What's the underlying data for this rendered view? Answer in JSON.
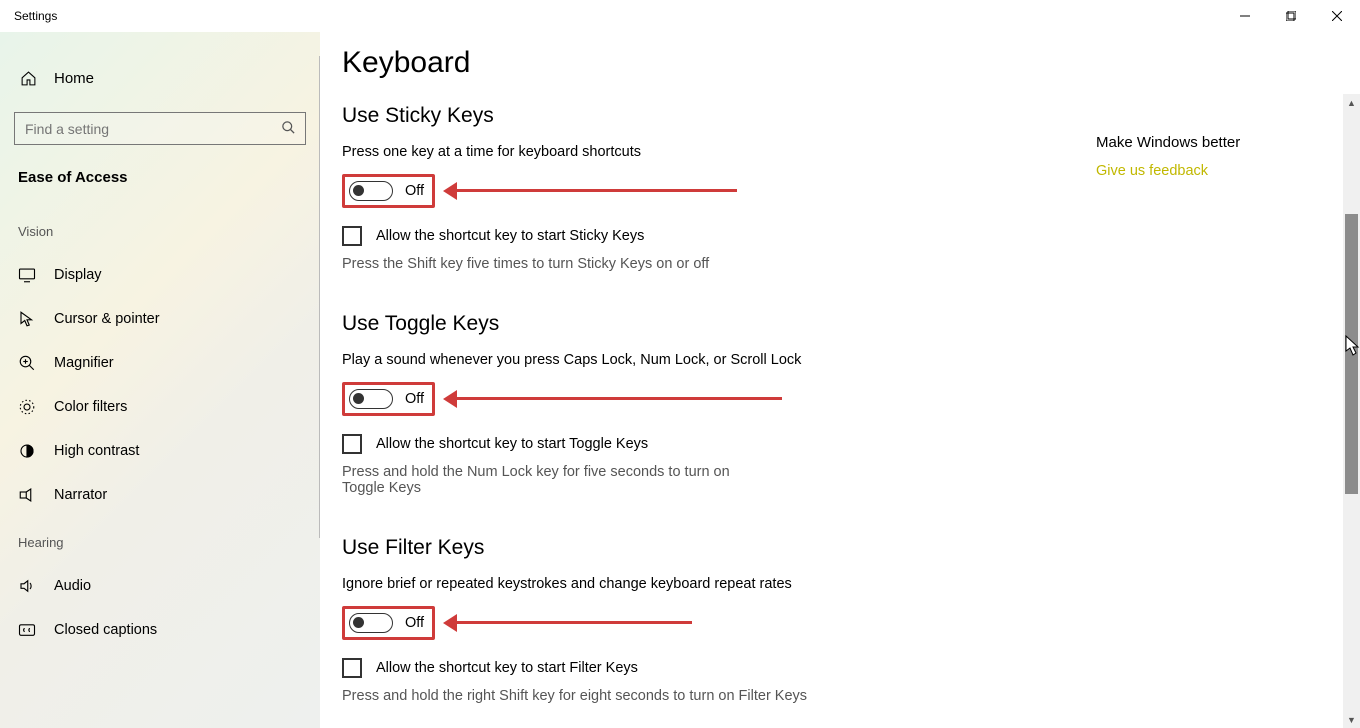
{
  "window": {
    "title": "Settings"
  },
  "sidebar": {
    "home": "Home",
    "search_placeholder": "Find a setting",
    "category": "Ease of Access",
    "groups": [
      {
        "label": "Vision",
        "items": [
          {
            "id": "display",
            "label": "Display"
          },
          {
            "id": "cursor",
            "label": "Cursor & pointer"
          },
          {
            "id": "magnifier",
            "label": "Magnifier"
          },
          {
            "id": "colorfilters",
            "label": "Color filters"
          },
          {
            "id": "highcontrast",
            "label": "High contrast"
          },
          {
            "id": "narrator",
            "label": "Narrator"
          }
        ]
      },
      {
        "label": "Hearing",
        "items": [
          {
            "id": "audio",
            "label": "Audio"
          },
          {
            "id": "cc",
            "label": "Closed captions"
          }
        ]
      }
    ]
  },
  "page": {
    "title": "Keyboard",
    "sections": [
      {
        "id": "sticky",
        "title": "Use Sticky Keys",
        "desc": "Press one key at a time for keyboard shortcuts",
        "toggle_state": "Off",
        "checkbox_label": "Allow the shortcut key to start Sticky Keys",
        "hint": "Press the Shift key five times to turn Sticky Keys on or off",
        "arrow_length": 280
      },
      {
        "id": "togglekeys",
        "title": "Use Toggle Keys",
        "desc": "Play a sound whenever you press Caps Lock, Num Lock, or Scroll Lock",
        "toggle_state": "Off",
        "checkbox_label": "Allow the shortcut key to start Toggle Keys",
        "hint": "Press and hold the Num Lock key for five seconds to turn on Toggle Keys",
        "arrow_length": 325
      },
      {
        "id": "filter",
        "title": "Use Filter Keys",
        "desc": "Ignore brief or repeated keystrokes and change keyboard repeat rates",
        "toggle_state": "Off",
        "checkbox_label": "Allow the shortcut key to start Filter Keys",
        "hint": "Press and hold the right Shift key for eight seconds to turn on Filter Keys",
        "arrow_length": 235
      }
    ]
  },
  "right": {
    "title": "Make Windows better",
    "link": "Give us feedback"
  },
  "annotation_color": "#cf3b3a"
}
